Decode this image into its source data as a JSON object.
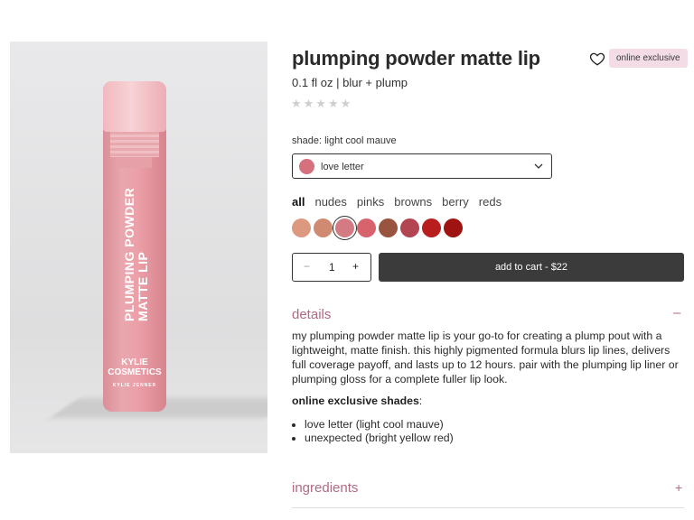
{
  "product": {
    "title": "plumping powder matte lip",
    "size": "0.1 fl oz | blur + plump",
    "stars": "★★★★★",
    "badge": "online exclusive",
    "image_text": "PLUMPING POWDER MATTE LIP",
    "brand_line1": "KYLIE",
    "brand_line2": "COSMETICS",
    "brand_line3": "KYLIE JENNER"
  },
  "shade": {
    "label": "shade: light cool mauve",
    "selected": "love letter",
    "selected_color": "#d6707c"
  },
  "filters": [
    "all",
    "nudes",
    "pinks",
    "browns",
    "berry",
    "reds"
  ],
  "swatches": [
    "#dd9880",
    "#d08a72",
    "#d37a82",
    "#d9636d",
    "#98543f",
    "#b34552",
    "#b81e1e",
    "#9f1313"
  ],
  "selected_swatch_index": 2,
  "quantity": {
    "minus": "−",
    "value": "1",
    "plus": "+"
  },
  "cart": {
    "label": "add to cart - $22"
  },
  "details": {
    "heading": "details",
    "toggle": "–",
    "description": "my plumping powder matte lip is your go-to for creating a plump pout with a lightweight, matte finish. this highly pigmented formula blurs lip lines, delivers full coverage payoff, and lasts up to 12 hours. pair with the plumping lip liner or plumping gloss for a complete fuller lip look.",
    "exclusive_label": "online exclusive shades",
    "exclusive_suffix": ":",
    "bullets": [
      "love letter (light cool mauve)",
      "unexpected (bright yellow red)"
    ]
  },
  "ingredients": {
    "heading": "ingredients",
    "toggle": "+"
  },
  "colors": {
    "accent": "#b06a82",
    "button": "#3b3b3b",
    "badge_bg": "#f3dce6"
  }
}
